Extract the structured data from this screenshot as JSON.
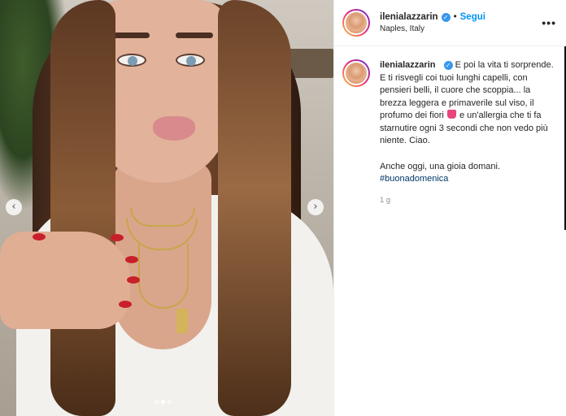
{
  "post": {
    "user": {
      "username": "ilenialazzarin",
      "location": "Naples, Italy",
      "follow_label": "Segui",
      "separator": "•",
      "more_icon": "more-horizontal-icon",
      "verified_icon": "verified-badge-icon"
    },
    "caption": {
      "username": "ilenialazzarin",
      "text_part1": "E poi la vita ti sorprende. E ti risvegli coi tuoi lunghi capelli, con pensieri belli, il cuore che scoppia... la brezza leggera e primaverile sul viso, il profumo dei fiori",
      "emoji_icon": "tulip-emoji-icon",
      "text_part2": "e un'allergia che ti fa starnutire ogni 3 secondi che non vedo più niente. Ciao.",
      "line2": "Anche oggi, una gioia domani.",
      "hashtag": "#buonadomenica"
    },
    "timestamp": "1 g",
    "media": {
      "prev_icon": "‹",
      "next_icon": "›",
      "carousel_count": 3,
      "carousel_active_index": 1
    }
  }
}
